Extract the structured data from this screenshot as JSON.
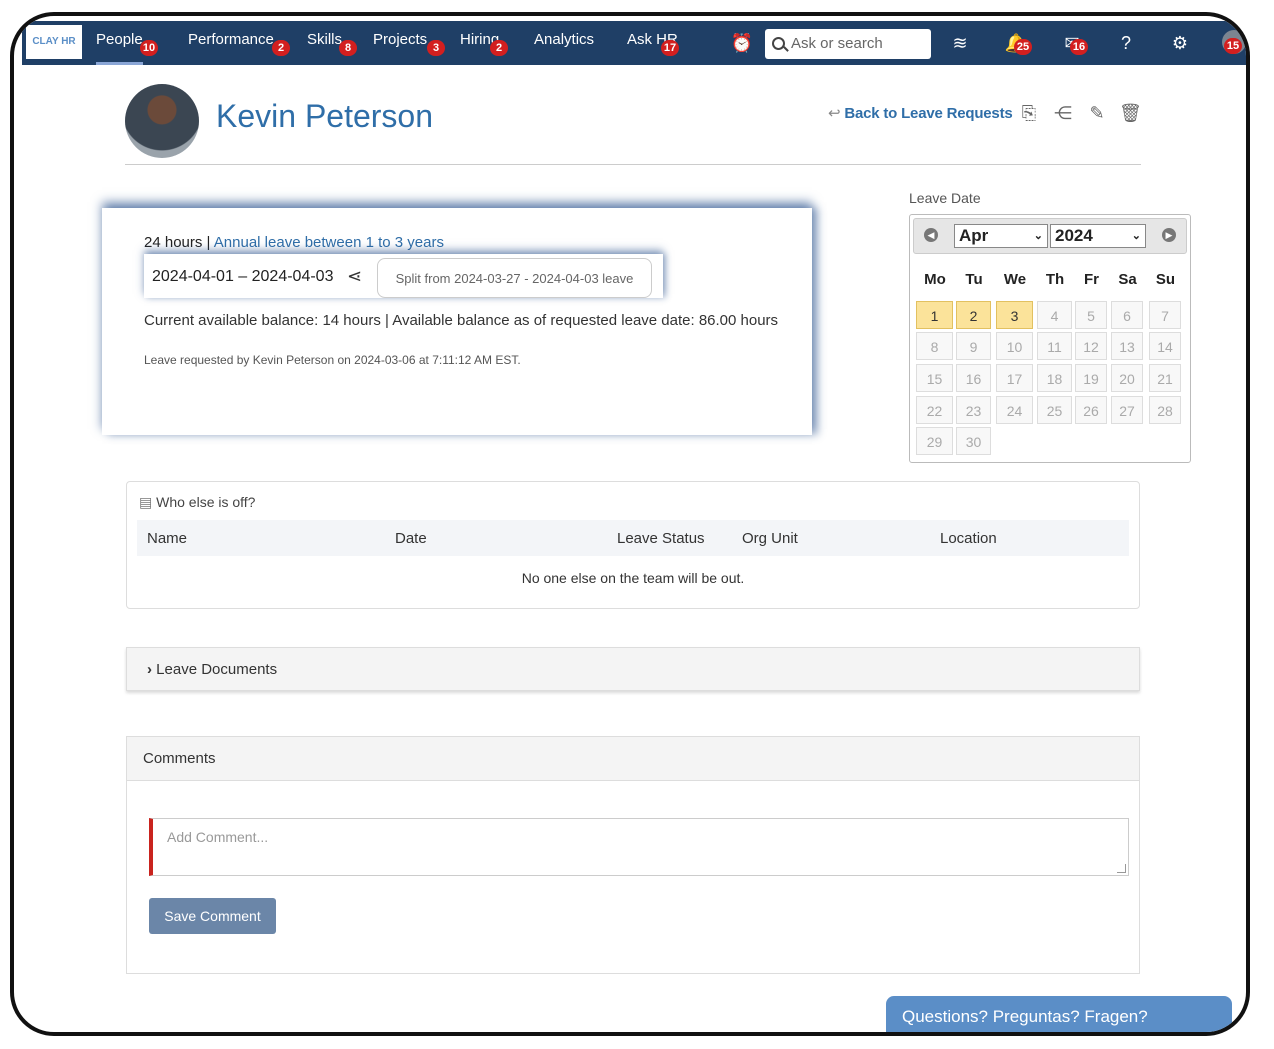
{
  "nav": {
    "logo": "CLAY HR",
    "items": [
      {
        "label": "People",
        "badge": "10"
      },
      {
        "label": "Performance",
        "badge": "2"
      },
      {
        "label": "Skills",
        "badge": "8"
      },
      {
        "label": "Projects",
        "badge": "3"
      },
      {
        "label": "Hiring",
        "badge": "2"
      },
      {
        "label": "Analytics",
        "badge": ""
      },
      {
        "label": "Ask HR",
        "badge": "17"
      }
    ],
    "search_placeholder": "Ask or search",
    "notifications_badge": "25",
    "messages_badge": "16",
    "avatar_badge": "15"
  },
  "header": {
    "employee_name": "Kevin Peterson",
    "back_link": "Back to Leave Requests"
  },
  "leave": {
    "hours": "24 hours",
    "separator": "|",
    "type": "Annual leave between 1 to 3 years",
    "date_range": "2024-04-01 – 2024-04-03",
    "split_note": "Split from 2024-03-27 - 2024-04-03 leave",
    "balance": "Current available balance: 14 hours | Available balance as of requested leave date: 86.00 hours",
    "requested_by": "Leave requested by Kevin Peterson on 2024-03-06 at 7:11:12 AM EST."
  },
  "calendar": {
    "label": "Leave Date",
    "month": "Apr",
    "year": "2024",
    "weekdays": [
      "Mo",
      "Tu",
      "We",
      "Th",
      "Fr",
      "Sa",
      "Su"
    ],
    "days": [
      "1",
      "2",
      "3",
      "4",
      "5",
      "6",
      "7",
      "8",
      "9",
      "10",
      "11",
      "12",
      "13",
      "14",
      "15",
      "16",
      "17",
      "18",
      "19",
      "20",
      "21",
      "22",
      "23",
      "24",
      "25",
      "26",
      "27",
      "28",
      "29",
      "30"
    ],
    "selected_days": [
      "1",
      "2",
      "3"
    ]
  },
  "who_else": {
    "title": "Who else is off?",
    "columns": [
      "Name",
      "Date",
      "Leave Status",
      "Org Unit",
      "Location"
    ],
    "empty_message": "No one else on the team will be out."
  },
  "documents": {
    "label": "Leave Documents"
  },
  "comments": {
    "title": "Comments",
    "placeholder": "Add Comment...",
    "save_label": "Save Comment"
  },
  "help": {
    "label": "Questions? Preguntas? Fragen?"
  }
}
